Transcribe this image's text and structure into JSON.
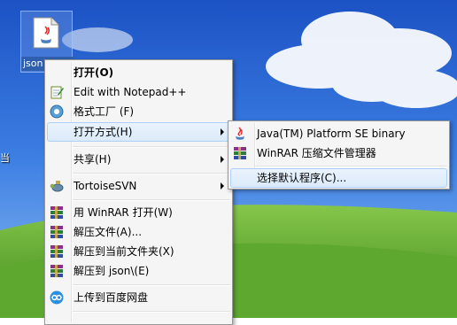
{
  "desktop": {
    "icon_label": "json",
    "left_edge_char": "当"
  },
  "context_menu": {
    "open": "打开(O)",
    "edit_notepad": "Edit with Notepad++",
    "format_factory": "格式工厂 (F)",
    "open_with": "打开方式(H)",
    "share": "共享(H)",
    "tortoise": "TortoiseSVN",
    "winrar_open": "用 WinRAR 打开(W)",
    "extract_files": "解压文件(A)...",
    "extract_here": "解压到当前文件夹(X)",
    "extract_to": "解压到 json\\(E)",
    "upload_baidu": "上传到百度网盘"
  },
  "submenu": {
    "java": "Java(TM) Platform SE binary",
    "winrar": "WinRAR 压缩文件管理器",
    "choose_default": "选择默认程序(C)..."
  },
  "icons": {
    "file": "java-file-icon",
    "notepad": "notepad-plus-plus-icon",
    "format_factory": "format-factory-icon",
    "java": "java-icon",
    "winrar": "winrar-books-icon",
    "tortoise": "tortoise-svn-icon",
    "baidu": "baidu-cloud-icon"
  },
  "colors": {
    "menu_bg": "#f5f5f5",
    "highlight": "#dbeaf9",
    "highlight_border": "#aecff7",
    "sky": "#2d6bd8",
    "grass": "#6fb13c"
  }
}
